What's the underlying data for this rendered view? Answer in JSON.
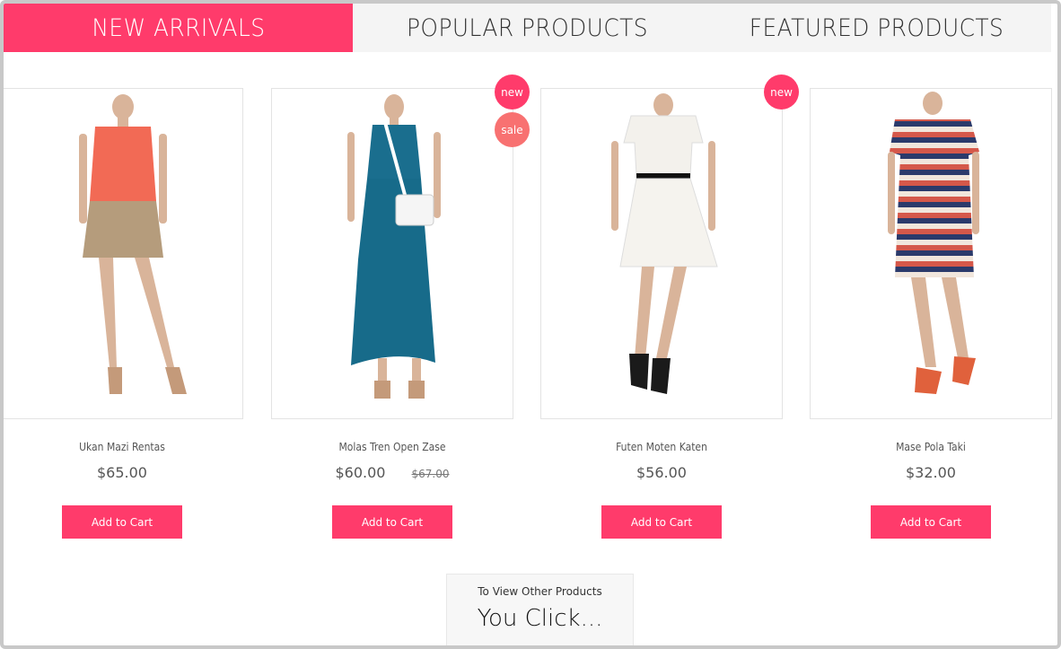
{
  "tabs": [
    {
      "label": "NEW ARRIVALS",
      "active": true
    },
    {
      "label": "POPULAR PRODUCTS",
      "active": false
    },
    {
      "label": "FEATURED PRODUCTS",
      "active": false
    }
  ],
  "products": [
    {
      "name": "Ukan Mazi Rentas",
      "price": "$65.00",
      "old_price": "",
      "badges": [],
      "cart_label": "Add to Cart",
      "dress": "coral-khaki-shift-dress"
    },
    {
      "name": "Molas Tren Open Zase",
      "price": "$60.00",
      "old_price": "$67.00",
      "badges": [
        "new",
        "sale"
      ],
      "cart_label": "Add to Cart",
      "dress": "teal-maxi-dress"
    },
    {
      "name": "Futen Moten Katen",
      "price": "$56.00",
      "old_price": "",
      "badges": [
        "new"
      ],
      "cart_label": "Add to Cart",
      "dress": "white-lace-dress"
    },
    {
      "name": "Mase Pola Taki",
      "price": "$32.00",
      "old_price": "",
      "badges": [],
      "cart_label": "Add to Cart",
      "dress": "striped-shift-dress"
    }
  ],
  "more": {
    "small": "To View Other Products",
    "big": "You Click..."
  },
  "colors": {
    "accent": "#ff3b6b",
    "sale": "#f87171",
    "tab_bg": "#f4f4f4"
  }
}
